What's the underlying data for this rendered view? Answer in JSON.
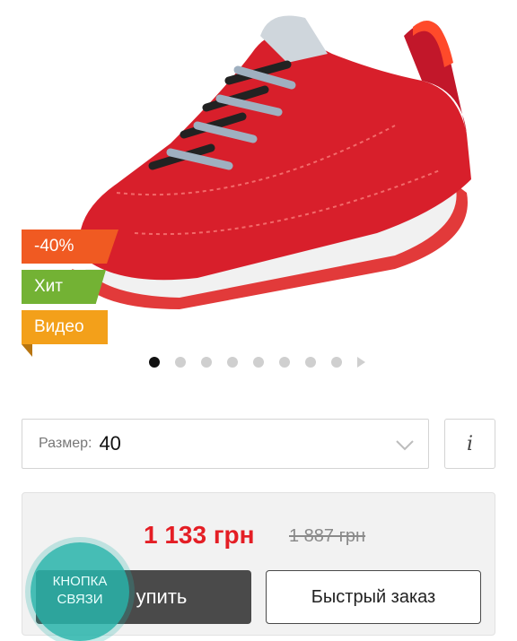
{
  "product": {
    "image_icon": "red-suede-sneaker-image",
    "badges": {
      "sale": "-40%",
      "hit": "Хит",
      "video": "Видео"
    },
    "gallery": {
      "total_dots": 8,
      "active_index": 0,
      "has_next_arrow": true
    }
  },
  "size": {
    "label": "Размер:",
    "value": "40"
  },
  "info_button": {
    "label": "i"
  },
  "pricing": {
    "price": "1 133 грн",
    "old_price": "1 887 грн"
  },
  "actions": {
    "buy_label": "упить",
    "quick_order_label": "Быстрый заказ"
  },
  "contact_widget": {
    "line1": "КНОПКА",
    "line2": "СВЯЗИ"
  },
  "colors": {
    "sale_badge": "#f05a22",
    "hit_badge": "#73b234",
    "video_badge": "#f3a01a",
    "price": "#e41e25",
    "contact_widget": "#28b4aa"
  }
}
